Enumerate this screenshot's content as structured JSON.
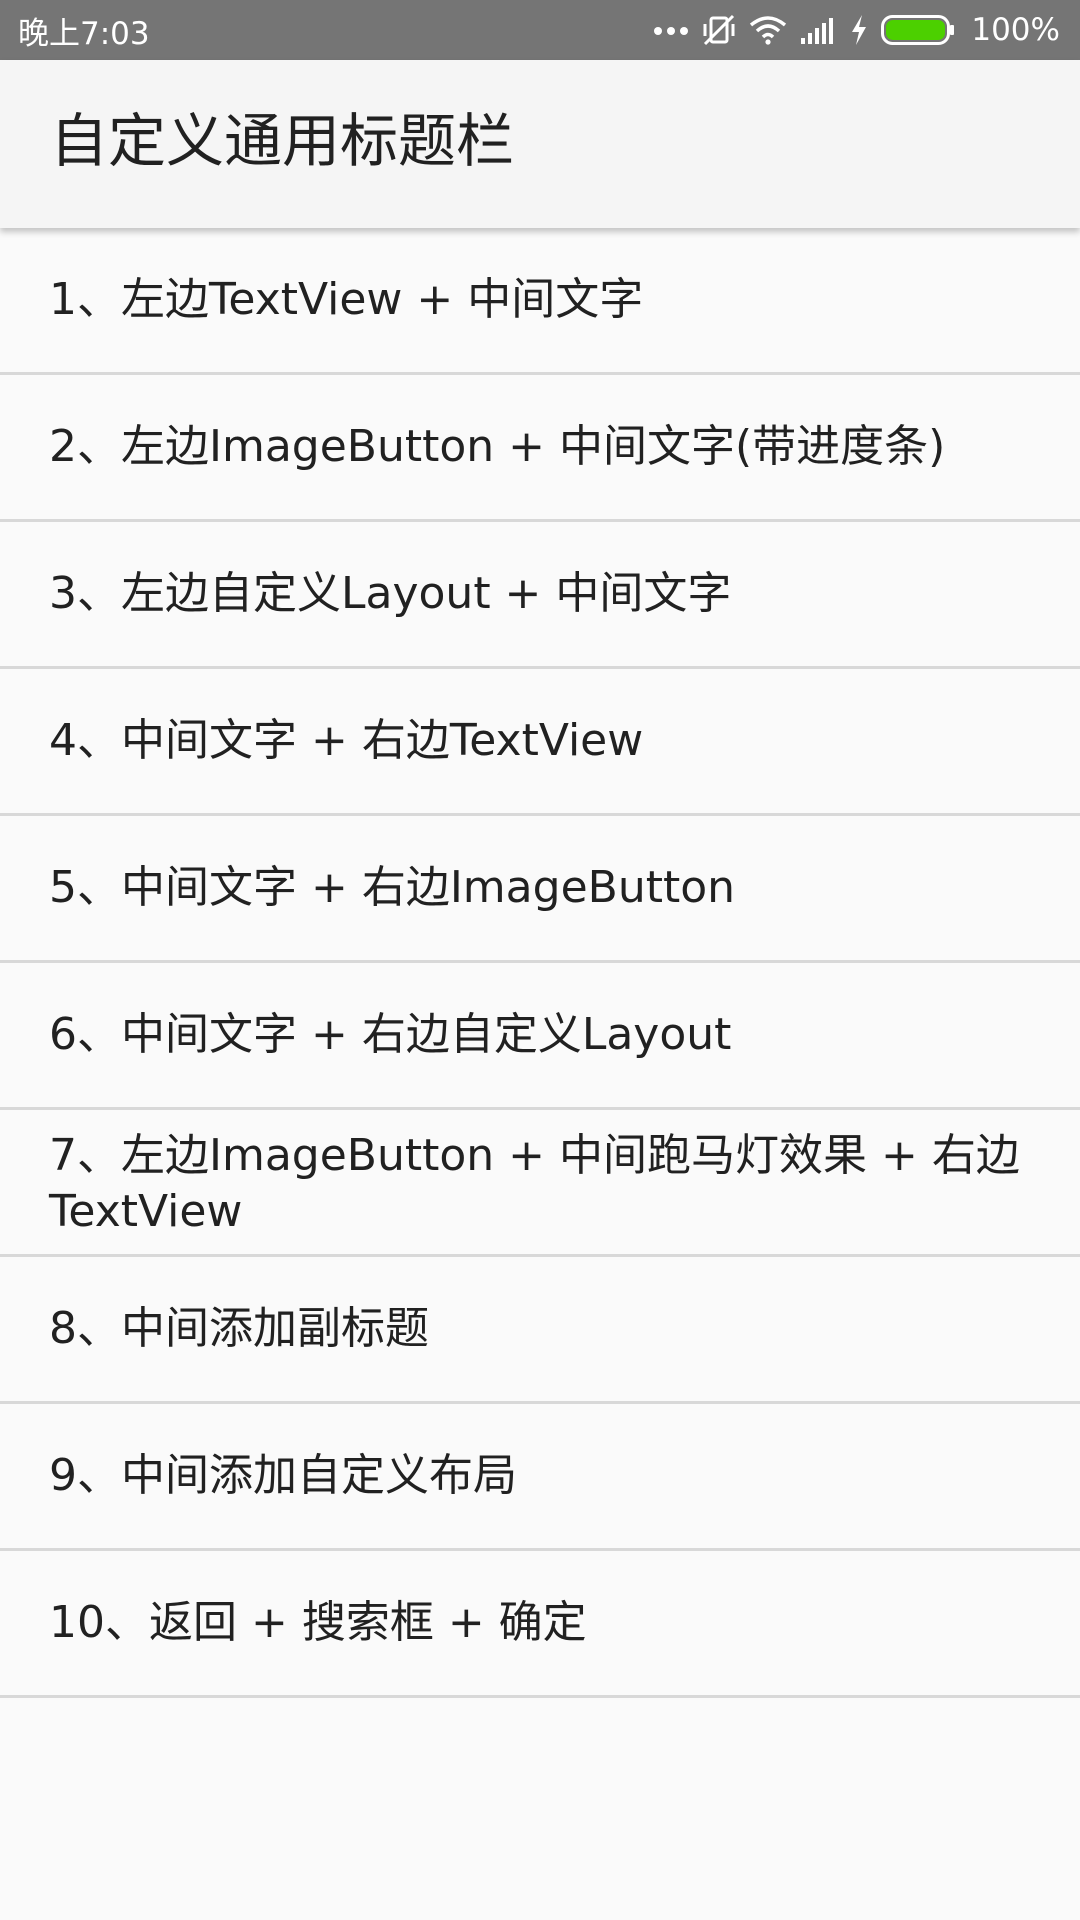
{
  "status_bar": {
    "time": "晚上7:03",
    "battery_percent": "100%",
    "icons": [
      "more-dots-icon",
      "mute-vibrate-icon",
      "wifi-icon",
      "signal-icon",
      "charging-bolt-icon",
      "battery-icon"
    ],
    "battery_color": "#4cd000"
  },
  "app_bar": {
    "title": "自定义通用标题栏"
  },
  "list": {
    "items": [
      {
        "label": "1、左边TextView + 中间文字"
      },
      {
        "label": "2、左边ImageButton + 中间文字(带进度条)"
      },
      {
        "label": "3、左边自定义Layout + 中间文字"
      },
      {
        "label": "4、中间文字 + 右边TextView"
      },
      {
        "label": "5、中间文字 + 右边ImageButton"
      },
      {
        "label": "6、中间文字 + 右边自定义Layout"
      },
      {
        "label": "7、左边ImageButton + 中间跑马灯效果 + 右边TextView"
      },
      {
        "label": "8、中间添加副标题"
      },
      {
        "label": "9、中间添加自定义布局"
      },
      {
        "label": "10、返回 + 搜索框 + 确定"
      }
    ]
  }
}
